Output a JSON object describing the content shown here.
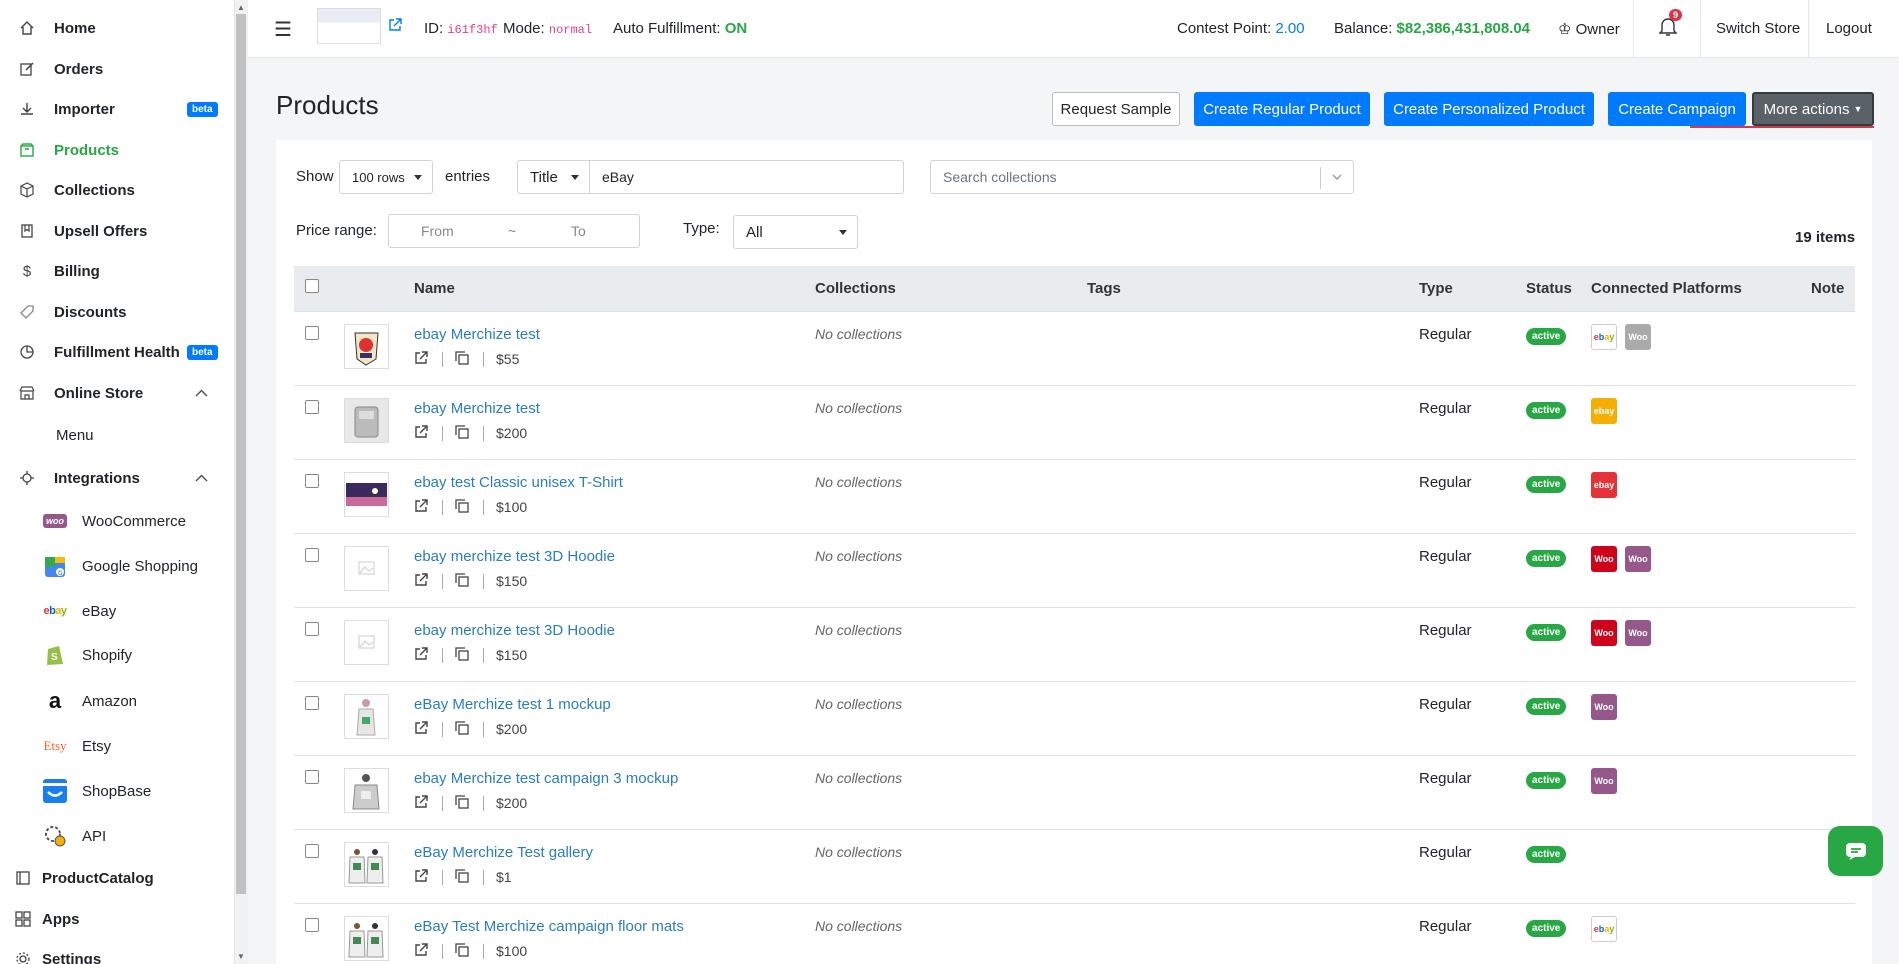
{
  "sidebar": {
    "items": [
      {
        "label": "Home",
        "icon": "home-icon"
      },
      {
        "label": "Orders",
        "icon": "edit-icon"
      },
      {
        "label": "Importer",
        "icon": "download-icon",
        "badge": "beta"
      },
      {
        "label": "Products",
        "icon": "box-icon"
      },
      {
        "label": "Collections",
        "icon": "cube-icon"
      },
      {
        "label": "Upsell Offers",
        "icon": "book-icon"
      },
      {
        "label": "Billing",
        "icon": "dollar-icon"
      },
      {
        "label": "Discounts",
        "icon": "tag-icon"
      },
      {
        "label": "Fulfillment Health",
        "icon": "pie-chart-icon",
        "badge": "beta"
      },
      {
        "label": "Online Store",
        "icon": "store-icon"
      },
      {
        "label": "Menu"
      },
      {
        "label": "Integrations",
        "icon": "plug-icon"
      },
      {
        "label": "WooCommerce",
        "icon": "woocommerce-icon"
      },
      {
        "label": "Google Shopping",
        "icon": "google-shopping-icon"
      },
      {
        "label": "eBay",
        "icon": "ebay-icon"
      },
      {
        "label": "Shopify",
        "icon": "shopify-icon"
      },
      {
        "label": "Amazon",
        "icon": "amazon-icon"
      },
      {
        "label": "Etsy",
        "icon": "etsy-icon"
      },
      {
        "label": "ShopBase",
        "icon": "shopbase-icon"
      },
      {
        "label": "API",
        "icon": "api-icon"
      },
      {
        "label": "ProductCatalog",
        "icon": "catalog-icon"
      },
      {
        "label": "Apps",
        "icon": "apps-icon"
      },
      {
        "label": "Settings",
        "icon": "gear-icon"
      }
    ]
  },
  "topbar": {
    "id_label": "ID:",
    "id_value": "i61f3hf",
    "mode_label": "Mode:",
    "mode_value": "normal",
    "auto_label": "Auto Fulfillment:",
    "auto_value": "ON",
    "contest_label": "Contest Point:",
    "contest_value": "2.00",
    "balance_label": "Balance:",
    "balance_value": "$82,386,431,808.04",
    "owner": "Owner",
    "notif_count": "9",
    "switch_store": "Switch Store",
    "logout": "Logout"
  },
  "page": {
    "title": "Products",
    "buttons": {
      "request_sample": "Request Sample",
      "create_regular": "Create Regular Product",
      "create_personalized": "Create Personalized Product",
      "create_campaign": "Create Campaign",
      "more_actions": "More actions"
    }
  },
  "filters": {
    "show_label": "Show",
    "rows_value": "100 rows",
    "entries_label": "entries",
    "field_value": "Title",
    "search_value": "eBay",
    "collections_placeholder": "Search collections",
    "price_label": "Price range:",
    "price_from": "From",
    "price_sep": "~",
    "price_to": "To",
    "type_label": "Type:",
    "type_value": "All",
    "items_count": "19 items"
  },
  "table": {
    "headers": [
      "Name",
      "Collections",
      "Tags",
      "Type",
      "Status",
      "Connected Platforms",
      "Note"
    ],
    "rows": [
      {
        "name": "ebay Merchize test",
        "price": "$55",
        "collections": "No collections",
        "type": "Regular",
        "status": "active",
        "platforms": [
          "ebay",
          "woo-gray"
        ]
      },
      {
        "name": "ebay Merchize test",
        "price": "$200",
        "collections": "No collections",
        "type": "Regular",
        "status": "active",
        "platforms": [
          "ebay-yellow"
        ]
      },
      {
        "name": "ebay test Classic unisex T-Shirt",
        "price": "$100",
        "collections": "No collections",
        "type": "Regular",
        "status": "active",
        "platforms": [
          "ebay-red"
        ]
      },
      {
        "name": "ebay merchize test 3D Hoodie",
        "price": "$150",
        "collections": "No collections",
        "type": "Regular",
        "status": "active",
        "platforms": [
          "woo-red",
          "woo-purple"
        ]
      },
      {
        "name": "ebay merchize test 3D Hoodie",
        "price": "$150",
        "collections": "No collections",
        "type": "Regular",
        "status": "active",
        "platforms": [
          "woo-red",
          "woo-purple"
        ]
      },
      {
        "name": "eBay Merchize test 1 mockup",
        "price": "$200",
        "collections": "No collections",
        "type": "Regular",
        "status": "active",
        "platforms": [
          "woo-purple"
        ]
      },
      {
        "name": "ebay Merchize test campaign 3 mockup",
        "price": "$200",
        "collections": "No collections",
        "type": "Regular",
        "status": "active",
        "platforms": [
          "woo-purple"
        ]
      },
      {
        "name": "eBay Merchize Test gallery",
        "price": "$1",
        "collections": "No collections",
        "type": "Regular",
        "status": "active",
        "platforms": []
      },
      {
        "name": "eBay Test Merchize campaign floor mats",
        "price": "$100",
        "collections": "No collections",
        "type": "Regular",
        "status": "active",
        "platforms": [
          "ebay"
        ]
      }
    ]
  },
  "platform_labels": {
    "ebay": "ebay",
    "woo": "Woo"
  },
  "colors": {
    "primary": "#007bff",
    "success": "#28a745",
    "danger": "#dc3545",
    "woo_purple": "#96588a"
  }
}
